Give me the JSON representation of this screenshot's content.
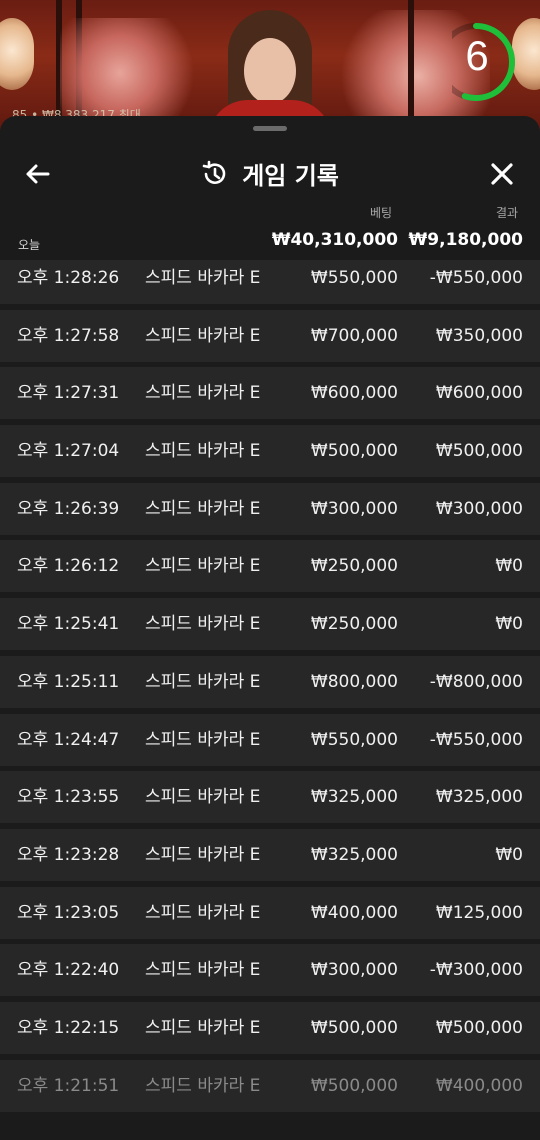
{
  "video": {
    "limits_text": "85 • ₩8,383,217 최대",
    "timer": "6",
    "timer_progress": 0.55
  },
  "header": {
    "title": "게임 기록",
    "back_icon": "back-arrow-icon",
    "close_icon": "close-icon",
    "history_icon": "history-icon"
  },
  "columns": {
    "bet_label": "베팅",
    "result_label": "결과",
    "today_label": "오늘",
    "bet_total": "₩40,310,000",
    "result_total": "₩9,180,000"
  },
  "rows": [
    {
      "time": "오후 1:28:26",
      "game": "스피드 바카라 E",
      "bet": "₩550,000",
      "result": "-₩550,000"
    },
    {
      "time": "오후 1:27:58",
      "game": "스피드 바카라 E",
      "bet": "₩700,000",
      "result": "₩350,000"
    },
    {
      "time": "오후 1:27:31",
      "game": "스피드 바카라 E",
      "bet": "₩600,000",
      "result": "₩600,000"
    },
    {
      "time": "오후 1:27:04",
      "game": "스피드 바카라 E",
      "bet": "₩500,000",
      "result": "₩500,000"
    },
    {
      "time": "오후 1:26:39",
      "game": "스피드 바카라 E",
      "bet": "₩300,000",
      "result": "₩300,000"
    },
    {
      "time": "오후 1:26:12",
      "game": "스피드 바카라 E",
      "bet": "₩250,000",
      "result": "₩0"
    },
    {
      "time": "오후 1:25:41",
      "game": "스피드 바카라 E",
      "bet": "₩250,000",
      "result": "₩0"
    },
    {
      "time": "오후 1:25:11",
      "game": "스피드 바카라 E",
      "bet": "₩800,000",
      "result": "-₩800,000"
    },
    {
      "time": "오후 1:24:47",
      "game": "스피드 바카라 E",
      "bet": "₩550,000",
      "result": "-₩550,000"
    },
    {
      "time": "오후 1:23:55",
      "game": "스피드 바카라 E",
      "bet": "₩325,000",
      "result": "₩325,000"
    },
    {
      "time": "오후 1:23:28",
      "game": "스피드 바카라 E",
      "bet": "₩325,000",
      "result": "₩0"
    },
    {
      "time": "오후 1:23:05",
      "game": "스피드 바카라 E",
      "bet": "₩400,000",
      "result": "₩125,000"
    },
    {
      "time": "오후 1:22:40",
      "game": "스피드 바카라 E",
      "bet": "₩300,000",
      "result": "-₩300,000"
    },
    {
      "time": "오후 1:22:15",
      "game": "스피드 바카라 E",
      "bet": "₩500,000",
      "result": "₩500,000"
    },
    {
      "time": "오후 1:21:51",
      "game": "스피드 바카라 E",
      "bet": "₩500,000",
      "result": "₩400,000"
    }
  ],
  "colors": {
    "timer_ring": "#1fbf3a",
    "sheet_bg": "#1b1b1b",
    "row_bg": "#272727"
  }
}
